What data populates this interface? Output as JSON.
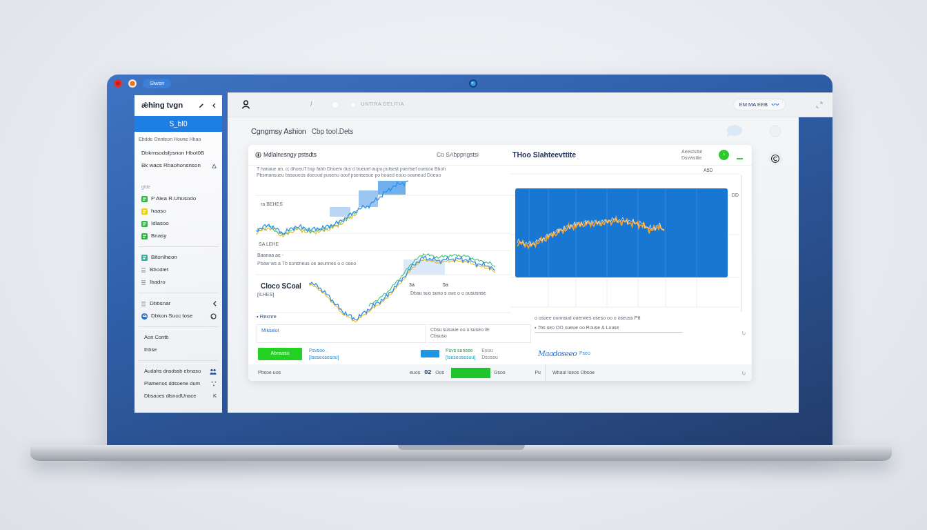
{
  "window": {
    "title": "Siwsn"
  },
  "sidebar": {
    "title": "ǽhing tvgn",
    "button": "S_bI0",
    "caption": "Ebdde Onnteon Houne Hhao",
    "groups": [
      {
        "items": [
          {
            "kind": "entry",
            "label": "Dbkrnsodsfpsnon Hbot0B"
          },
          {
            "kind": "entry",
            "label": "Bk wacs Rbaohonsnson",
            "end": {
              "kind": "triangle"
            }
          },
          {
            "kind": "faint",
            "label": "gide"
          },
          {
            "kind": "tile",
            "label": "P Alea R.Uhusodo",
            "color": "#34b34a"
          },
          {
            "kind": "tile",
            "label": "haaso",
            "color": "#f0d20f"
          },
          {
            "kind": "tile",
            "label": "Idlasoo",
            "color": "#34b34a"
          },
          {
            "kind": "tile",
            "label": "Bnasy",
            "color": "#34b34a"
          }
        ]
      },
      {
        "items": [
          {
            "kind": "tile",
            "label": "Bitonlheon",
            "color": "#2bb3a3"
          },
          {
            "kind": "menu",
            "label": "Bbodiet"
          },
          {
            "kind": "menu",
            "label": "Ibadro"
          }
        ]
      },
      {
        "items": [
          {
            "kind": "menu",
            "label": "Dbbsnar",
            "end": {
              "kind": "chevron"
            }
          },
          {
            "kind": "logo",
            "label": "Dbkon Succ tose",
            "end": {
              "kind": "ring"
            }
          }
        ]
      },
      {
        "items": [
          {
            "kind": "plain",
            "label": "Aon Contb"
          },
          {
            "kind": "plain",
            "label": "Ihhse"
          }
        ]
      },
      {
        "items": [
          {
            "kind": "plain",
            "label": "Audahs dnsdssb ebnaso",
            "end": {
              "kind": "people"
            }
          },
          {
            "kind": "plain",
            "label": "Plamenos ddsoene dum",
            "end": {
              "kind": "dots"
            }
          },
          {
            "kind": "plain",
            "label": "Dbsaoes dlsnodUnace",
            "end_text": "K"
          }
        ]
      }
    ]
  },
  "toolbar": {
    "separator": "/",
    "breadcrumb": "UNTIRA DELITIA",
    "account": "EM MA EEB"
  },
  "page": {
    "title": "Cgngmsy Ashion",
    "subtitle": "Cbp tool.Dets"
  },
  "card": {
    "title": "Mdlalnesngy pstsdts",
    "subtitle": "Co SAbppngstsi",
    "chart_title": "THoo Slahteevttite",
    "legend": [
      "Aeestsitie",
      "Dsvwsitie"
    ],
    "captions": [
      "T hanaue an, o; dhoeuT bsp fahb Dhoem dus d bueuef aupo pufsest puensef ouesoo Bhoh",
      "Pbsmansueu bssoueos doeoud pusenu oouf psensesue po boued eouo oouneud Doeuo"
    ],
    "left_labels": [
      "ra BEHES",
      "SA LEHE",
      "Baanaa ae ·",
      "Pbaw ws a Tb sonsneus oe aeunnes o o oseo",
      "Cloco SCoal",
      "[ILHES]",
      "3a",
      "5a",
      "Dbau suo suno s oue o o oususnse",
      "• Rexnre"
    ],
    "right_labels": [
      "A5D",
      "DD"
    ],
    "notes": [
      "o osuee ounnsud ouennes oseso oo o oseuss Ptt",
      "• 7bs seo OO oueue oo Rouse & Louse"
    ],
    "details": {
      "box_a": "Mikseloi",
      "box_b": [
        "Cbsu susoue oo o suseo IE",
        "Cbsuso"
      ]
    },
    "actions": {
      "button": "Abnsaso",
      "link_a": [
        "Psvsoo .",
        "[Iseseosesou]"
      ],
      "link_b": [
        "Psvs sunsee",
        "[Iseseosesou]"
      ],
      "info": [
        "Euou",
        "Dsosou"
      ],
      "signature": "Maadoseeo",
      "signature_note": "Pseo"
    },
    "footer": {
      "left": "Pbsoe uos",
      "mid": [
        "euos",
        "02",
        "Oos"
      ],
      "tag": "Gsoo",
      "mark": "Pu",
      "right": "Wbaui Iseos Obsoe"
    }
  }
}
